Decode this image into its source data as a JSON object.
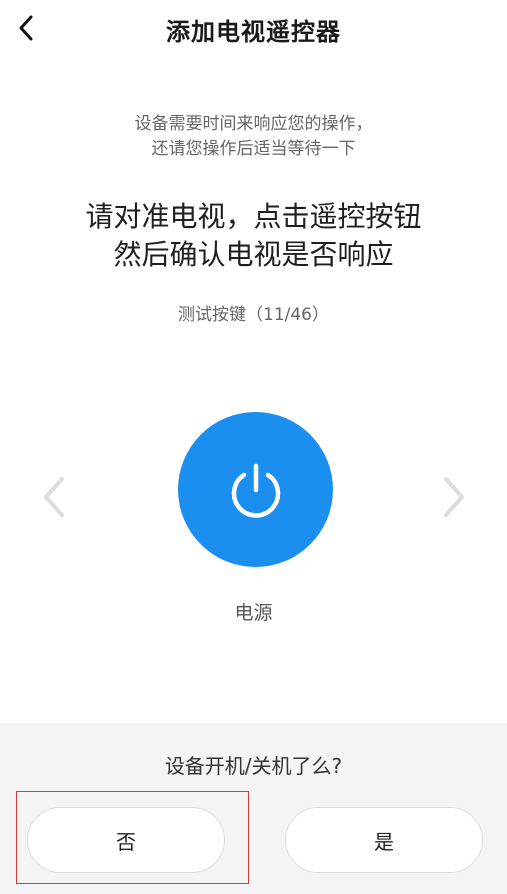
{
  "header": {
    "title": "添加电视遥控器",
    "back_icon": "chevron-left-icon"
  },
  "hint": {
    "line1": "设备需要时间来响应您的操作，",
    "line2": "还请您操作后适当等待一下"
  },
  "instruction": {
    "line1": "请对准电视，点击遥控按钮",
    "line2": "然后确认电视是否响应"
  },
  "progress": {
    "text": "测试按键（11/46）",
    "current": 11,
    "total": 46
  },
  "remote_key": {
    "icon": "power-icon",
    "label": "电源",
    "color": "#1a8ff0"
  },
  "navigation": {
    "prev_icon": "chevron-left-icon",
    "next_icon": "chevron-right-icon"
  },
  "confirm": {
    "question": "设备开机/关机了么?",
    "no_label": "否",
    "yes_label": "是"
  }
}
